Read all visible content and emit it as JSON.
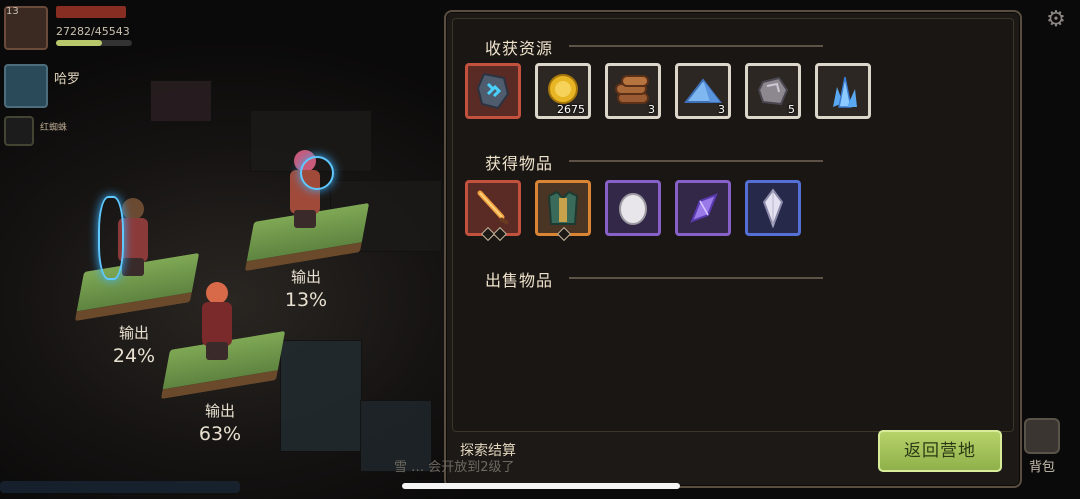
{
  "player": {
    "name": "██████",
    "hp_text": "27282/45543",
    "hp_fraction": 0.6,
    "level": "13"
  },
  "allies": [
    {
      "name": "哈罗"
    },
    {
      "name": "红蜘蛛"
    }
  ],
  "heroes": [
    {
      "label": "输出",
      "percent": "24%"
    },
    {
      "label": "输出",
      "percent": "13%"
    },
    {
      "label": "输出",
      "percent": "63%"
    }
  ],
  "panel": {
    "sections": {
      "resources": "收获资源",
      "items": "获得物品",
      "sold": "出售物品"
    },
    "resources": [
      {
        "icon": "rune-stone-icon",
        "qty": "",
        "rarity": "red"
      },
      {
        "icon": "gold-coin-icon",
        "qty": "2675",
        "rarity": "white"
      },
      {
        "icon": "wood-logs-icon",
        "qty": "3",
        "rarity": "white"
      },
      {
        "icon": "blue-sand-icon",
        "qty": "3",
        "rarity": "white"
      },
      {
        "icon": "iron-ore-icon",
        "qty": "5",
        "rarity": "white"
      },
      {
        "icon": "blue-crystal-icon",
        "qty": "",
        "rarity": "white"
      }
    ],
    "items": [
      {
        "icon": "flame-sword-icon",
        "rarity": "red"
      },
      {
        "icon": "armor-icon",
        "rarity": "orange"
      },
      {
        "icon": "egg-icon",
        "rarity": "purple"
      },
      {
        "icon": "purple-crystal-icon",
        "rarity": "purple"
      },
      {
        "icon": "white-crystal-icon",
        "rarity": "blue"
      }
    ],
    "settle_label": "探索结算",
    "return_button": "返回营地"
  },
  "hud": {
    "bag_label": "背包",
    "chat_text": "雪 … 会开放到2级了"
  },
  "colors": {
    "accent_green": "#b7d36a",
    "rarity_red": "#c2523e",
    "rarity_orange": "#d98534",
    "rarity_purple": "#8760c8",
    "rarity_blue": "#5470d4"
  }
}
